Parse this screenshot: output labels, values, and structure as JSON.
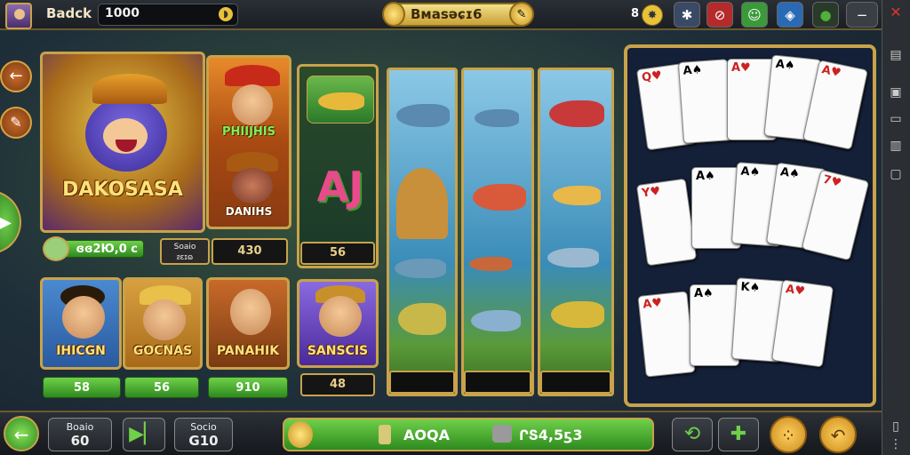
{
  "header": {
    "player_name": "Badck",
    "balance": "1000",
    "title": "Bмasəɕɪ6",
    "count": "8"
  },
  "left_nav": {
    "back_arrow": "←",
    "tools_glyph": "✎",
    "play_glyph": "▶"
  },
  "games": {
    "main": {
      "title": "DAKOSASA",
      "amount": "ɞɞ2Ю,0 c"
    },
    "panel2": {
      "top_title": "PHIIJHIS",
      "bottom_title": "DANIHS"
    },
    "mini": {
      "label_top": "Soaio",
      "label_bot": "ᴤɛɪɷ",
      "value": "430"
    },
    "small": [
      {
        "title": "IHICGN",
        "value": "58"
      },
      {
        "title": "GOCNAS",
        "value": "56"
      },
      {
        "title": "PANAHIK",
        "value": "910"
      },
      {
        "title": "SANSCIS",
        "value": "48"
      }
    ],
    "symbol_panel": {
      "letters": "AJ",
      "value": "56"
    }
  },
  "bottom": {
    "btn1_top": "Boaio",
    "btn1_bot": "60",
    "btn3_top": "Socio",
    "btn3_bot": "G10",
    "center_label": "AOQA",
    "center_value": "ՐՏ4,5ƽ3"
  },
  "colors": {
    "gold": "#c9a24a",
    "green": "#4fb03a"
  }
}
